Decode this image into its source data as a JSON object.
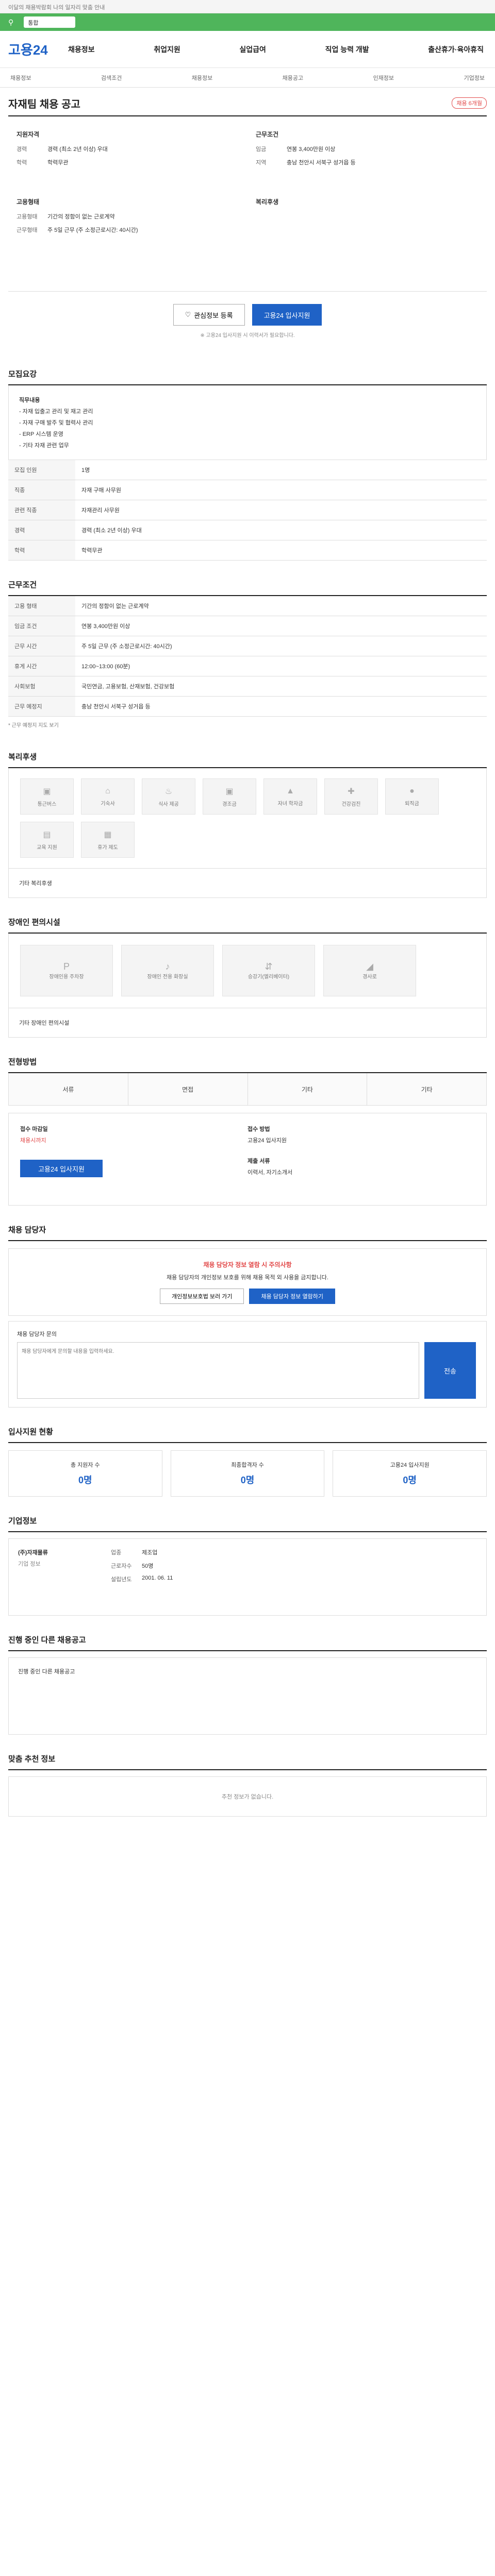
{
  "topbar": {
    "notice": "이달의 채용박람회 나의 일자리 맞춤 안내"
  },
  "search": {
    "pill": "통합"
  },
  "brand": {
    "logo": "고용24"
  },
  "gnb": [
    "채용정보",
    "취업지원",
    "실업급여",
    "직업 능력 개발",
    "출산휴가·육아휴직"
  ],
  "subnav": [
    "채용정보",
    "검색조건",
    "채용정보",
    "채용공고",
    "인재정보",
    "기업정보"
  ],
  "job": {
    "title": "자재팀 채용 공고",
    "badge": "채용 6개월"
  },
  "company": {
    "left_title": "지원자격",
    "left": [
      {
        "k": "경력",
        "v": "경력 (최소 2년 이상) 우대"
      },
      {
        "k": "학력",
        "v": "학력무관"
      }
    ],
    "left2_title": "고용형태",
    "left2": [
      {
        "k": "고용형태",
        "v": "기간의 정함이 없는 근로계약"
      },
      {
        "k": "근무형태",
        "v": "주 5일 근무 (주 소정근로시간: 40시간)"
      }
    ],
    "right_title": "근무조건",
    "right": [
      {
        "k": "임금",
        "v": "연봉 3,400만원 이상"
      },
      {
        "k": "지역",
        "v": "충남 천안시 서북구 성거읍 등"
      }
    ],
    "right2_title": "복리후생"
  },
  "actions": {
    "scrap": "관심정보 등록",
    "apply": "고용24 입사지원"
  },
  "action_note": "※ 고용24 입사지원 시 이력서가 필요합니다.",
  "sections": {
    "recruit": "모집요강",
    "detail_title": "직무내용",
    "detail_lines": [
      "- 자재 입출고 관리 및 재고 관리",
      "- 자재 구매 발주 및 협력사 관리",
      "- ERP 시스템 운영",
      "- 기타 자재 관련 업무"
    ],
    "work": "근무조건",
    "benefit": "복리후생",
    "disabled": "장애인 편의시설",
    "method": "전형방법",
    "manager": "채용 담당자",
    "stats": "입사지원 현황",
    "company_info": "기업정보",
    "similar": "진행 중인 다른 채용공고",
    "recommend": "맞춤 추천 정보"
  },
  "recruit_rows": [
    {
      "h": "모집 인원",
      "v": "1명"
    },
    {
      "h": "직종",
      "v": "자재 구매 사무원"
    },
    {
      "h": "관련 직종",
      "v": "자재관리 사무원"
    },
    {
      "h": "경력",
      "v": "경력 (최소 2년 이상) 우대"
    },
    {
      "h": "학력",
      "v": "학력무관"
    }
  ],
  "work_rows": [
    {
      "h": "고용 형태",
      "v": "기간의 정함이 없는 근로계약"
    },
    {
      "h": "임금 조건",
      "v": "연봉 3,400만원 이상"
    },
    {
      "h": "근무 시간",
      "v": "주 5일 근무 (주 소정근로시간: 40시간)"
    },
    {
      "h": "휴게 시간",
      "v": "12:00~13:00 (60분)"
    },
    {
      "h": "사회보험",
      "v": "국민연금, 고용보험, 산재보험, 건강보험"
    },
    {
      "h": "근무 예정지",
      "v": "충남 천안시 서북구 성거읍 등"
    }
  ],
  "work_note": "* 근무 예정지 지도 보기",
  "benefit_items": [
    "통근버스",
    "기숙사",
    "식사 제공",
    "경조금",
    "자녀 학자금",
    "건강검진",
    "퇴직금",
    "교육 지원",
    "휴가 제도"
  ],
  "benefit_note": "기타 복리후생",
  "disabled_items": [
    "장애인용 주차장",
    "장애인 전용 화장실",
    "승강기(엘리베이터)",
    "경사로"
  ],
  "disabled_note": "기타 장애인 편의시설",
  "method_tabs": [
    "서류",
    "면접",
    "기타",
    "기타"
  ],
  "apply": {
    "l_title": "접수 마감일",
    "l_value": "채용시까지",
    "l_btn": "고용24 입사지원",
    "r_title": "접수 방법",
    "r_value": "고용24 입사지원",
    "r2_title": "제출 서류",
    "r2_value": "이력서, 자기소개서"
  },
  "manager_alert": "채용 담당자 정보 열람 시 주의사항",
  "manager_alert_sub": "채용 담당자의 개인정보 보호를 위해 채용 목적 외 사용을 금지합니다.",
  "manager_btns": {
    "a": "개인정보보호법 보러 가기",
    "b": "채용 담당자 정보 열람하기"
  },
  "inquiry": {
    "title": "채용 담당자 문의",
    "placeholder": "채용 담당자에게 문의할 내용을 입력하세요.",
    "send": "전송"
  },
  "stats": [
    {
      "label": "총 지원자 수",
      "value": "0명"
    },
    {
      "label": "최종합격자 수",
      "value": "0명"
    },
    {
      "label": "고용24 입사지원",
      "value": "0명"
    }
  ],
  "company_footer": {
    "name": "(주)자재물류",
    "label": "기업 정보",
    "fields": [
      {
        "k": "업종",
        "v": "제조업"
      },
      {
        "k": "근로자수",
        "v": "50명"
      },
      {
        "k": "설립년도",
        "v": "2001. 06. 11"
      }
    ]
  },
  "similar_title": "진행 중인 다른 채용공고",
  "recommend_empty": "추천 정보가 없습니다."
}
